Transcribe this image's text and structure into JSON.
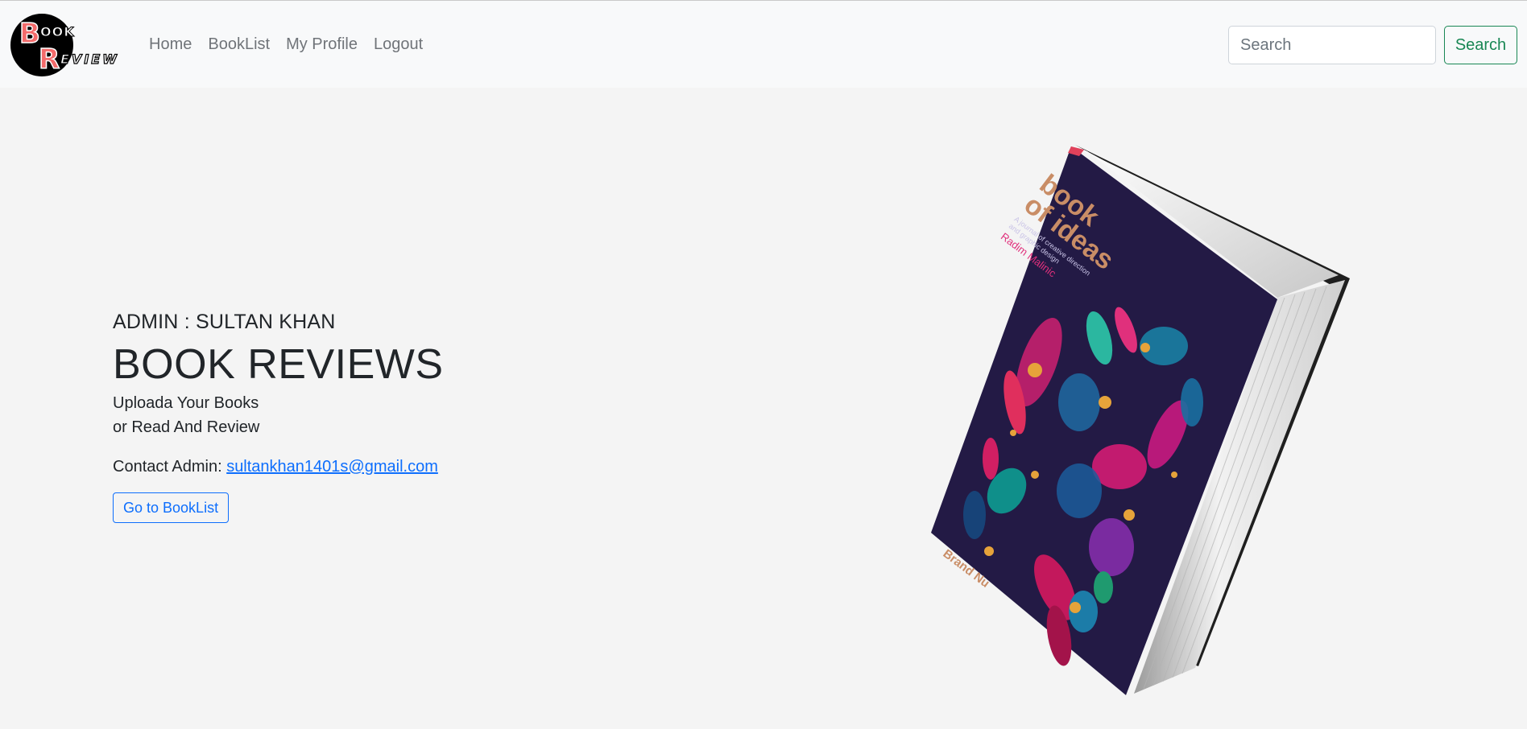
{
  "brand": {
    "logo_letters": [
      "B",
      "OOK",
      "R",
      "EVIEW"
    ],
    "colors": {
      "circle": "#000000",
      "letter": "#f26b6b",
      "outline": "#ffffff"
    }
  },
  "nav": {
    "items": [
      {
        "label": "Home"
      },
      {
        "label": "BookList"
      },
      {
        "label": "My Profile"
      },
      {
        "label": "Logout"
      }
    ]
  },
  "search": {
    "placeholder": "Search",
    "value": "",
    "button_label": "Search"
  },
  "hero": {
    "admin_line": "ADMIN : SULTAN KHAN",
    "title": "BOOK REVIEWS",
    "tagline_1": "Uploada Your Books",
    "tagline_2": "or Read And Review",
    "contact_label": "Contact Admin: ",
    "contact_email": "sultankhan1401s@gmail.com",
    "cta_label": "Go to BookList"
  },
  "book": {
    "title_line_1": "book",
    "title_line_2": "of ideas",
    "subtitle_1": "A journal of creative direction",
    "subtitle_2": "and graphic design",
    "author": "Radim Malinic",
    "publisher": "Brand Nu"
  },
  "colors": {
    "nav_bg": "#f8f9fa",
    "page_bg": "#f4f4f4",
    "success": "#198754",
    "primary": "#0d6efd",
    "book_cover": "#231a45",
    "book_title": "#c98d66"
  }
}
